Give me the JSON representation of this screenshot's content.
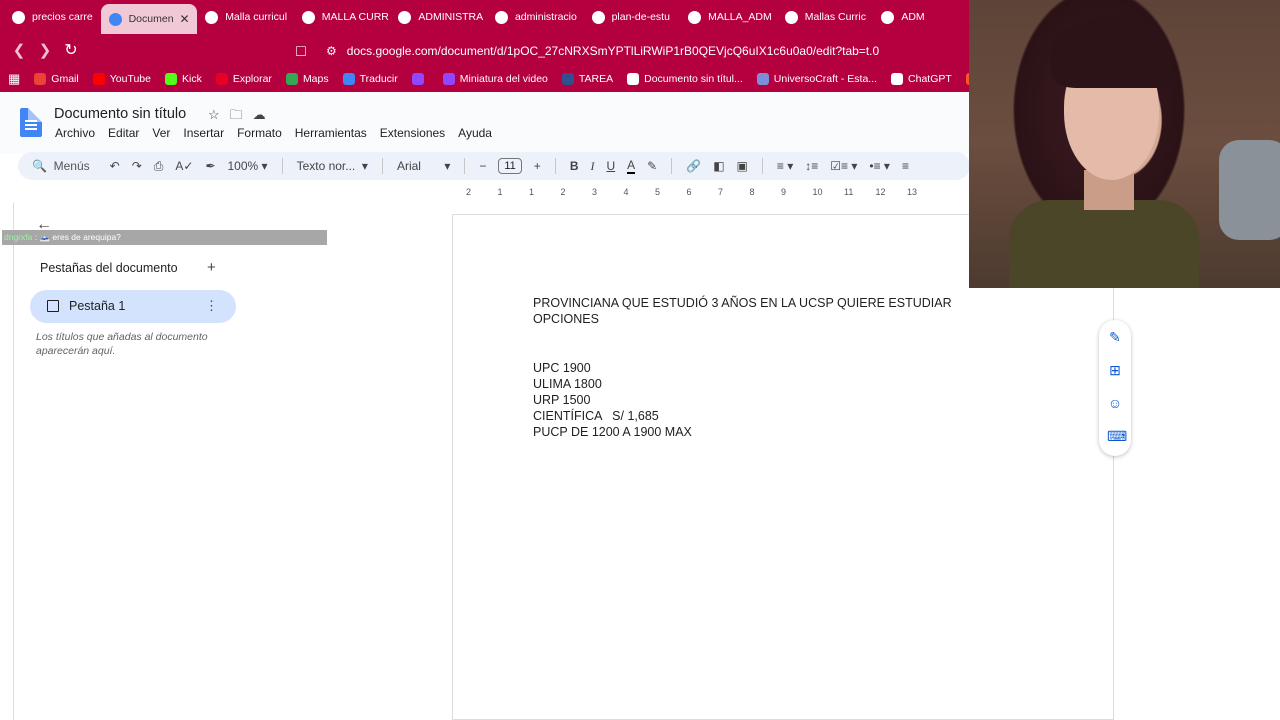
{
  "browser": {
    "tabs": [
      {
        "label": "precios carre",
        "color": "#ffffff",
        "icon": "google-icon"
      },
      {
        "label": "Documen",
        "color": "#4285f4",
        "icon": "docs-icon",
        "active": true
      },
      {
        "label": "Malla curricul",
        "color": "#ffffff",
        "icon": "university-icon"
      },
      {
        "label": "MALLA CURR",
        "color": "#ffffff",
        "icon": "google-icon"
      },
      {
        "label": "ADMINISTRA",
        "color": "#ffffff",
        "icon": "google-icon"
      },
      {
        "label": "administracio",
        "color": "#ffffff",
        "icon": "pdf-icon"
      },
      {
        "label": "plan-de-estu",
        "color": "#ffffff",
        "icon": "pdf-icon"
      },
      {
        "label": "MALLA_ADM",
        "color": "#ffffff",
        "icon": "pdf-icon"
      },
      {
        "label": "Mallas Curric",
        "color": "#ffffff",
        "icon": "university-icon"
      },
      {
        "label": "ADM",
        "color": "#ffffff",
        "icon": "pdf-icon"
      }
    ],
    "url": "docs.google.com/document/d/1pOC_27cNRXSmYPTlLiRWiP1rB0QEVjcQ6uIX1c6u0a0/edit?tab=t.0",
    "bookmarks": [
      {
        "label": "Gmail",
        "color": "#ea4335"
      },
      {
        "label": "YouTube",
        "color": "#ff0000"
      },
      {
        "label": "Kick",
        "color": "#53fc18"
      },
      {
        "label": "Explorar",
        "color": "#e60023"
      },
      {
        "label": "Maps",
        "color": "#34a853"
      },
      {
        "label": "Traducir",
        "color": "#4285f4"
      },
      {
        "label": "",
        "color": "#9146ff"
      },
      {
        "label": "Miniatura del video",
        "color": "#9146ff"
      },
      {
        "label": "TAREA",
        "color": "#2f4f8f"
      },
      {
        "label": "Documento sin títul...",
        "color": "#ffffff"
      },
      {
        "label": "UniversoCraft - Esta...",
        "color": "#7b8fd8"
      },
      {
        "label": "ChatGPT",
        "color": "#ffffff"
      },
      {
        "label": "",
        "color": "#fb542b"
      }
    ]
  },
  "docs": {
    "title": "Documento sin título",
    "menu": [
      "Archivo",
      "Editar",
      "Ver",
      "Insertar",
      "Formato",
      "Herramientas",
      "Extensiones",
      "Ayuda"
    ],
    "toolbar": {
      "search": "Menús",
      "zoom": "100%",
      "style": "Texto nor...",
      "font": "Arial",
      "size": "11",
      "bold": "B",
      "italic": "I",
      "underline": "U",
      "textcolor": "A"
    },
    "ruler": [
      "2",
      "1",
      "1",
      "2",
      "3",
      "4",
      "5",
      "6",
      "7",
      "8",
      "9",
      "10",
      "11",
      "12",
      "13"
    ],
    "sidebar": {
      "heading": "Pestañas del documento",
      "tab_label": "Pestaña 1",
      "hint": "Los títulos que añadas al documento aparecerán aquí."
    },
    "body": {
      "line1": "PROVINCIANA QUE ESTUDIÓ 3 AÑOS EN LA UCSP QUIERE ESTUDIAR",
      "line2": "OPCIONES",
      "items": [
        "UPC 1900",
        "ULIMA 1800",
        "URP 1500",
        "CIENTÍFICA   S/ 1,685",
        "PUCP DE 1200 A 1900 MAX"
      ]
    }
  },
  "chat": {
    "user": "dngrxfa",
    "message": "eres de arequipa?"
  }
}
